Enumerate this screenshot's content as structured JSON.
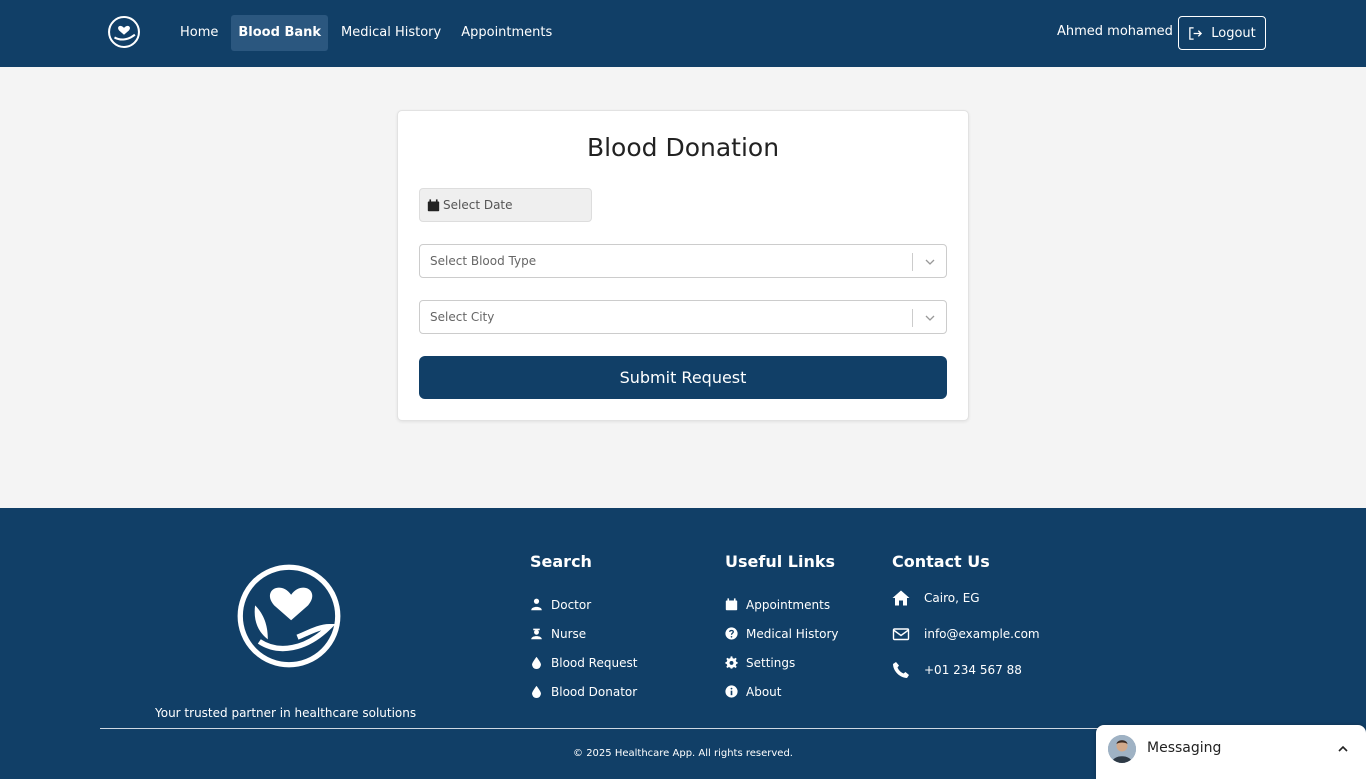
{
  "nav": {
    "links": [
      {
        "label": "Home",
        "active": false
      },
      {
        "label": "Blood Bank",
        "active": true
      },
      {
        "label": "Medical History",
        "active": false
      },
      {
        "label": "Appointments",
        "active": false
      }
    ],
    "user_name": "Ahmed mohamed",
    "logout_label": "Logout"
  },
  "form": {
    "title": "Blood Donation",
    "date_placeholder": "Select Date",
    "blood_type_placeholder": "Select Blood Type",
    "city_placeholder": "Select City",
    "submit_label": "Submit Request"
  },
  "footer": {
    "tagline": "Your trusted partner in healthcare solutions",
    "search": {
      "title": "Search",
      "items": [
        {
          "label": "Doctor",
          "icon": "user-md-icon"
        },
        {
          "label": "Nurse",
          "icon": "nurse-icon"
        },
        {
          "label": "Blood Request",
          "icon": "blood-drop-icon"
        },
        {
          "label": "Blood Donator",
          "icon": "blood-drop-icon"
        }
      ]
    },
    "useful": {
      "title": "Useful Links",
      "items": [
        {
          "label": "Appointments",
          "icon": "calendar-icon"
        },
        {
          "label": "Medical History",
          "icon": "question-icon"
        },
        {
          "label": "Settings",
          "icon": "gear-icon"
        },
        {
          "label": "About",
          "icon": "info-icon"
        }
      ]
    },
    "contact": {
      "title": "Contact Us",
      "items": [
        {
          "label": "Cairo, EG",
          "icon": "home-icon"
        },
        {
          "label": "info@example.com",
          "icon": "envelope-icon"
        },
        {
          "label": "+01 234 567 88",
          "icon": "phone-icon"
        }
      ]
    },
    "copyright": "© 2025 Healthcare App. All rights reserved."
  },
  "messaging": {
    "label": "Messaging"
  },
  "colors": {
    "primary": "#113f67",
    "active_nav": "#2b577f",
    "background": "#f4f4f4"
  }
}
